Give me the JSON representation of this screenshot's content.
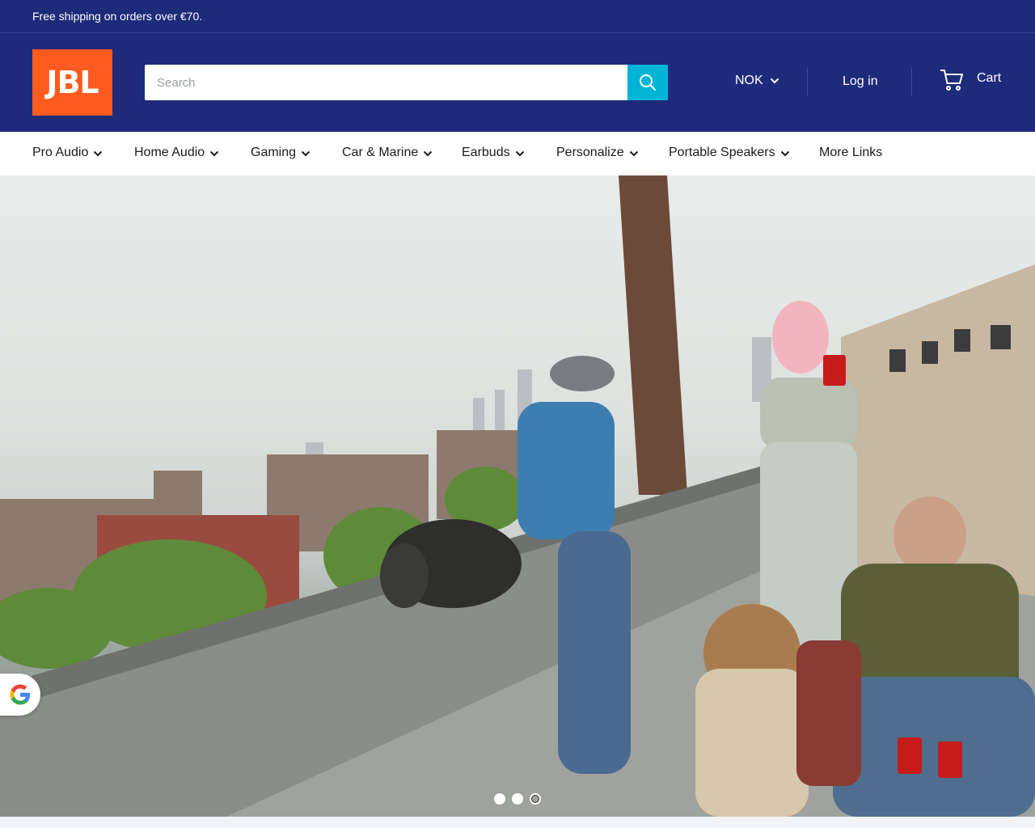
{
  "announcement": {
    "text": "Free shipping on orders over €70."
  },
  "header": {
    "logo_text": "JBL",
    "search": {
      "placeholder": "Search",
      "value": ""
    },
    "currency": "NOK",
    "login_label": "Log in",
    "cart_label": "Cart"
  },
  "nav": {
    "items": [
      {
        "label": "Pro Audio",
        "has_dropdown": true
      },
      {
        "label": "Home Audio",
        "has_dropdown": true
      },
      {
        "label": "Gaming",
        "has_dropdown": true
      },
      {
        "label": "Car & Marine",
        "has_dropdown": true
      },
      {
        "label": "Earbuds",
        "has_dropdown": true
      },
      {
        "label": "Personalize",
        "has_dropdown": true
      },
      {
        "label": "Portable Speakers",
        "has_dropdown": true
      },
      {
        "label": "More Links",
        "has_dropdown": false
      }
    ]
  },
  "hero": {
    "slides": 3,
    "active_slide": 3
  },
  "icons": {
    "search": "search-icon",
    "chevron": "chevron-down-icon",
    "cart": "cart-icon",
    "google": "google-icon"
  },
  "colors": {
    "header_bg": "#1e2b7a",
    "logo_bg": "#ff5a1f",
    "search_button": "#00b4d8"
  }
}
